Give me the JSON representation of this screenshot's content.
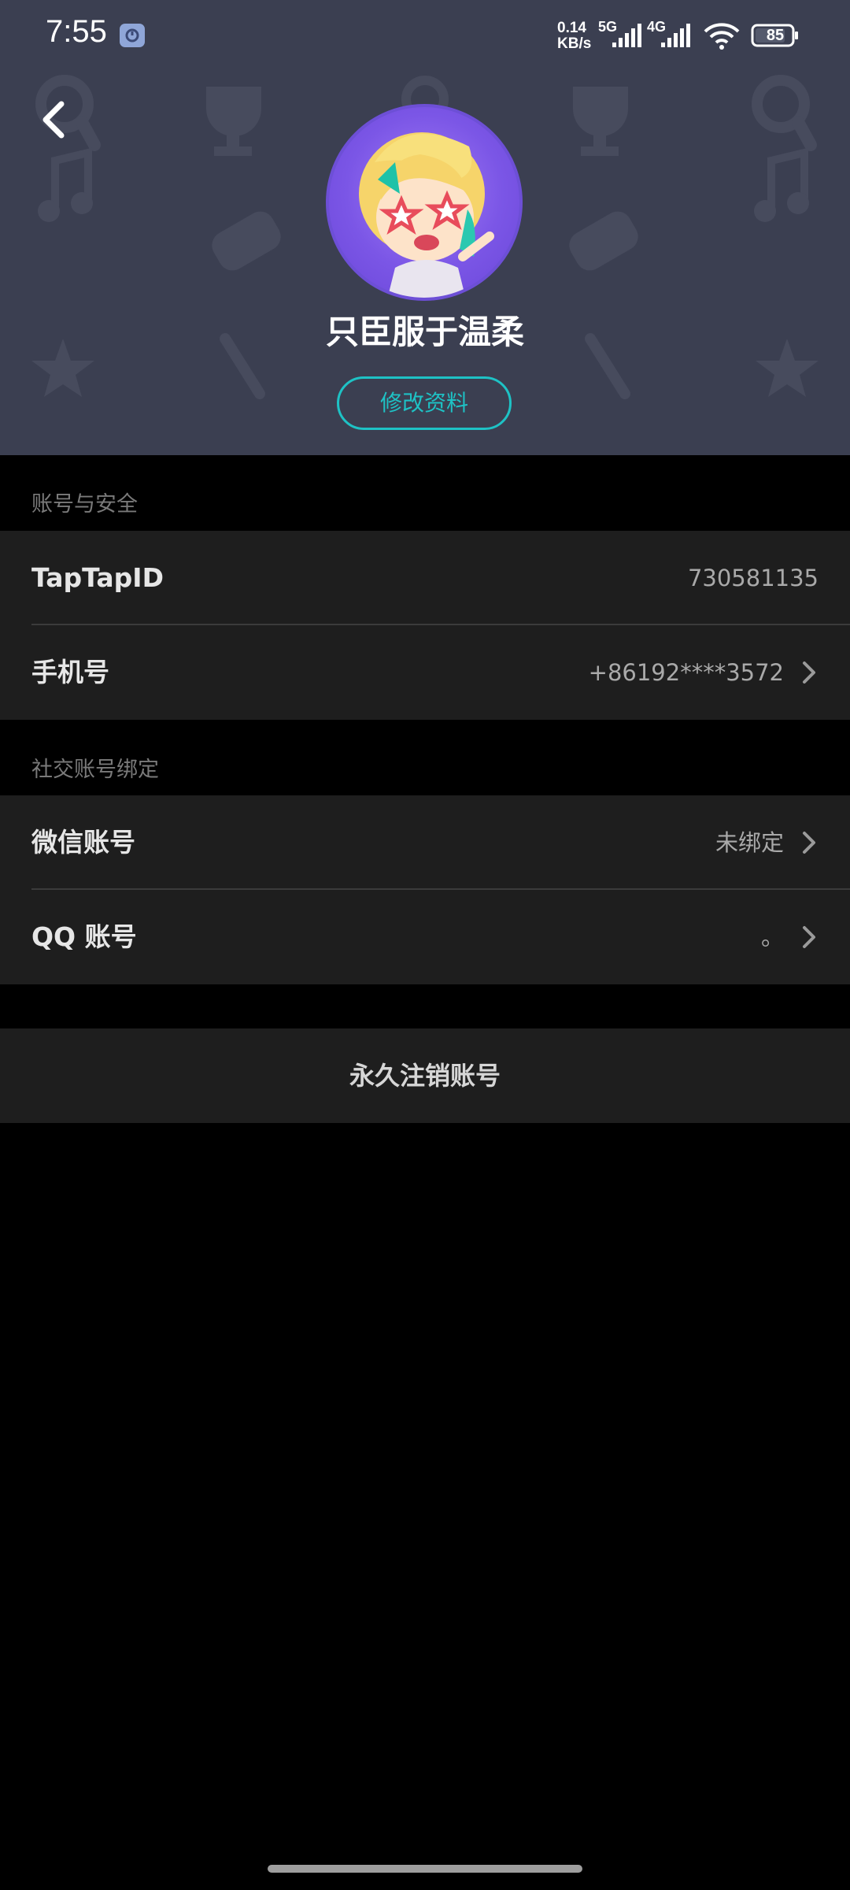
{
  "status_bar": {
    "time": "7:55",
    "net_speed_value": "0.14",
    "net_speed_unit": "KB/s",
    "signal_1_label": "5G",
    "signal_2_label": "4G",
    "battery_level": "85"
  },
  "profile": {
    "username": "只臣服于温柔",
    "edit_button_label": "修改资料"
  },
  "sections": {
    "account_security": {
      "title": "账号与安全",
      "taptap_id_label": "TapTapID",
      "taptap_id_value": "730581135",
      "phone_label": "手机号",
      "phone_value": "+86192****3572"
    },
    "social_binding": {
      "title": "社交账号绑定",
      "wechat_label": "微信账号",
      "wechat_value": "未绑定",
      "qq_label": "QQ 账号",
      "qq_value": "。"
    }
  },
  "delete_account_label": "永久注销账号",
  "colors": {
    "hero_bg": "#3b3f51",
    "accent": "#1ec2c5",
    "row_bg": "#1e1e1e",
    "page_bg": "#000000"
  },
  "icons": [
    "back-arrow-icon",
    "chevron-right-icon",
    "wifi-icon",
    "signal-icon",
    "battery-icon"
  ]
}
